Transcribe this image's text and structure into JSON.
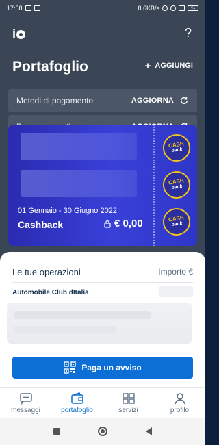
{
  "status_bar": {
    "time": "17:58",
    "network_speed": "8,6KB/s",
    "battery": "41"
  },
  "header": {
    "title": "Portafoglio",
    "add_label": "AGGIUNGI",
    "help_label": "?"
  },
  "rows": [
    {
      "label": "Metodi di pagamento",
      "action": "AGGIORNA"
    },
    {
      "label": "Bonus e sconti",
      "action": "AGGIORNA"
    }
  ],
  "cashback_card": {
    "period": "01 Gennaio - 30 Giugno 2022",
    "name": "Cashback",
    "amount": "€ 0,00",
    "badge_top": "CASH",
    "badge_bottom": "back"
  },
  "operations": {
    "title": "Le tue operazioni",
    "amount_header": "Importo €",
    "first_item": "Automobile Club dItalia"
  },
  "pay_button": {
    "label": "Paga un avviso"
  },
  "tabs": [
    {
      "label": "messaggi",
      "icon": "chat-icon",
      "active": false
    },
    {
      "label": "portafoglio",
      "icon": "wallet-icon",
      "active": true
    },
    {
      "label": "servizi",
      "icon": "services-icon",
      "active": false
    },
    {
      "label": "profilo",
      "icon": "profile-icon",
      "active": false
    }
  ],
  "colors": {
    "header_bg": "#3a4655",
    "accent": "#0b6fd6",
    "card_blue": "#3940d8",
    "cashback_yellow": "#f2c318"
  }
}
